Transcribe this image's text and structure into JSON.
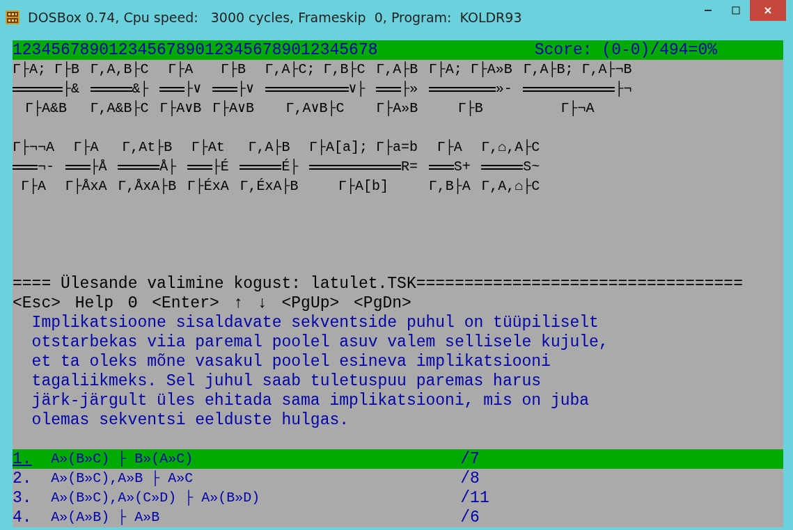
{
  "window": {
    "title": "DOSBox 0.74, Cpu speed:   3000 cycles, Frameskip  0, Program:  KOLDR93"
  },
  "status_bar": {
    "ruler": "12345678901234567890123456789012345678",
    "score": "Score: (0-0)/494=0%"
  },
  "rule_rows": [
    [
      {
        "premises": "Γ├A; Γ├B",
        "label": "├&",
        "conclusion": "Γ├A&B"
      },
      {
        "premises": "Γ,A,B├C",
        "label": "&├",
        "conclusion": "Γ,A&B├C"
      },
      {
        "premises": "Γ├A",
        "label": "├∨",
        "conclusion": "Γ├A∨B"
      },
      {
        "premises": "Γ├B",
        "label": "├∨",
        "conclusion": "Γ├A∨B"
      },
      {
        "premises": "Γ,A├C; Γ,B├C",
        "label": "∨├",
        "conclusion": "Γ,A∨B├C"
      },
      {
        "premises": "Γ,A├B",
        "label": "├»",
        "conclusion": "Γ├A»B"
      },
      {
        "premises": "Γ├A; Γ├A»B",
        "label": "»-",
        "conclusion": "Γ├B"
      },
      {
        "premises": "Γ,A├B; Γ,A├¬B",
        "label": "├¬",
        "conclusion": "Γ├¬A"
      }
    ],
    [
      {
        "premises": "Γ├¬¬A",
        "label": "¬-",
        "conclusion": "Γ├A"
      },
      {
        "premises": "Γ├A",
        "label": "├Å",
        "conclusion": "Γ├ÅxA"
      },
      {
        "premises": "Γ,At├B",
        "label": "Å├",
        "conclusion": "Γ,ÅxA├B"
      },
      {
        "premises": "Γ├At",
        "label": "├É",
        "conclusion": "Γ├ÉxA"
      },
      {
        "premises": "Γ,A├B",
        "label": "É├",
        "conclusion": "Γ,ÉxA├B"
      },
      {
        "premises": "Γ├A[a]; Γ├a=b",
        "label": "R=",
        "conclusion": "Γ├A[b]"
      },
      {
        "premises": "Γ├A",
        "label": "S+",
        "conclusion": "Γ,B├A"
      },
      {
        "premises": "Γ,⌂,A├C",
        "label": "S~",
        "conclusion": "Γ,A,⌂├C"
      }
    ]
  ],
  "header": "==== Ülesande valimine kogust: latulet.TSK==================================",
  "keys": [
    "<Esc>",
    "Help",
    "Θ",
    "<Enter>",
    "↑",
    "↓",
    "<PgUp>",
    "<PgDn>"
  ],
  "description": [
    "Implikatsioone sisaldavate sekventside puhul on tüüpiliselt",
    "otstarbekas viia paremal poolel asuv valem sellisele kujule,",
    "et ta oleks mõne vasakul poolel esineva implikatsiooni",
    "tagaliikmeks. Sel juhul saab tuletuspuu paremas harus",
    "järk-järgult üles ehitada sama implikatsiooni, mis on juba",
    "olemas sekventsi eelduste hulgas."
  ],
  "tasks": [
    {
      "number": "1.",
      "formula": "A»(B»C) ├ B»(A»C)",
      "score": "/7",
      "selected": true
    },
    {
      "number": "2.",
      "formula": "A»(B»C),A»B ├ A»C",
      "score": "/8",
      "selected": false
    },
    {
      "number": "3.",
      "formula": "A»(B»C),A»(C»D) ├ A»(B»D)",
      "score": "/11",
      "selected": false
    },
    {
      "number": "4.",
      "formula": "A»(A»B) ├ A»B",
      "score": "/6",
      "selected": false
    }
  ]
}
